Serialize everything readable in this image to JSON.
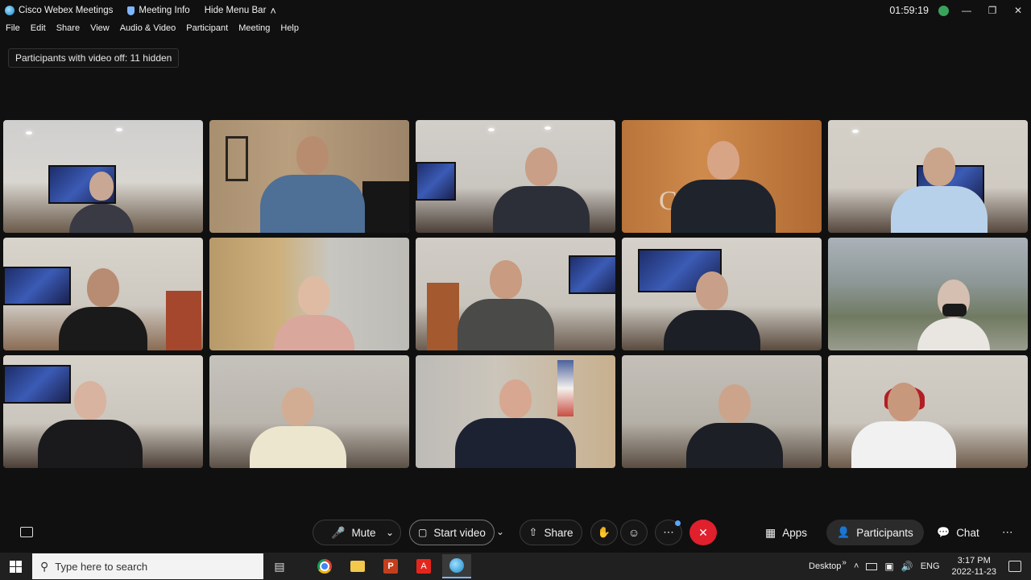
{
  "titlebar": {
    "app_name": "Cisco Webex Meetings",
    "meeting_info": "Meeting Info",
    "hide_menu": "Hide Menu Bar",
    "clock": "01:59:19"
  },
  "menu": [
    "File",
    "Edit",
    "Share",
    "View",
    "Audio & Video",
    "Participant",
    "Meeting",
    "Help"
  ],
  "hidden_notice": "Participants with video off: 11 hidden",
  "controls": {
    "mute": "Mute",
    "start_video": "Start video",
    "share": "Share",
    "apps": "Apps",
    "participants": "Participants",
    "chat": "Chat"
  },
  "taskbar": {
    "search_placeholder": "Type here to search",
    "desktop": "Desktop",
    "lang": "ENG",
    "time": "3:17 PM",
    "date": "2022-11-23"
  },
  "icons": {
    "caret_up": "˄",
    "more": "⋯",
    "overflow": "»"
  },
  "colors": {
    "end_call": "#e0202c",
    "status": "#3aa35b",
    "accent": "#7fb6ff"
  }
}
